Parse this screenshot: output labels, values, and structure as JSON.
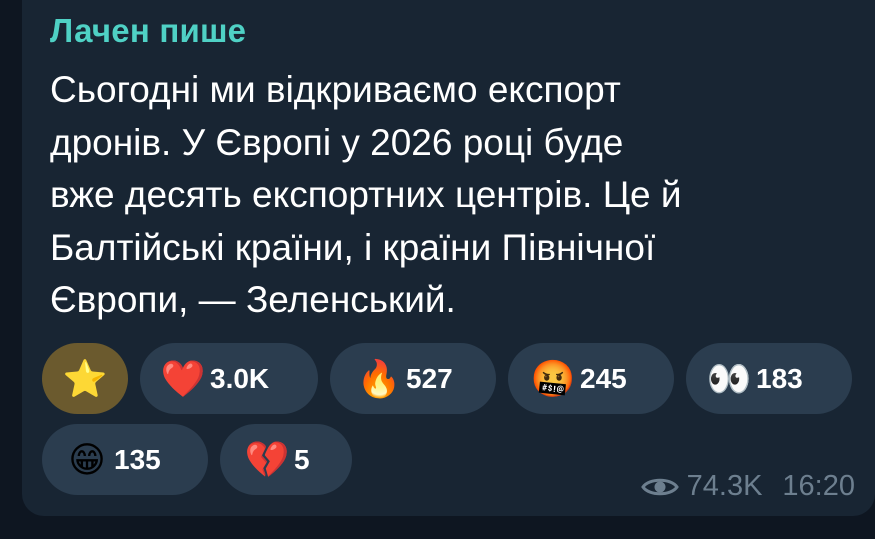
{
  "post": {
    "author": "Лачен пише",
    "text": "Сьогодні ми відкриваємо експорт\nдронів. У Європі у 2026 році буде\nвже десять експортних центрів. Це й\nБалтійські країни, і країни Північної\nЄвропи, — Зеленський.",
    "views": "74.3K",
    "time": "16:20"
  },
  "reactions": [
    {
      "emoji": "⭐",
      "icon": "star-icon",
      "count": ""
    },
    {
      "emoji": "❤️",
      "icon": "red-heart-icon",
      "count": "3.0K"
    },
    {
      "emoji": "🔥",
      "icon": "fire-icon",
      "count": "527"
    },
    {
      "emoji": "🤬",
      "icon": "cursing-face-icon",
      "count": "245"
    },
    {
      "emoji": "👀",
      "icon": "eyes-icon",
      "count": "183"
    },
    {
      "emoji": "😁",
      "icon": "grinning-face-icon",
      "count": "135"
    },
    {
      "emoji": "💔",
      "icon": "broken-heart-icon",
      "count": "5"
    }
  ],
  "colors": {
    "author": "#4fd1c5",
    "bubble": "#182533",
    "background": "#0e1621",
    "reaction_bg": "#2b3d4f",
    "reaction_selected_bg": "#6b5a2e",
    "meta": "#6d7f8f"
  }
}
